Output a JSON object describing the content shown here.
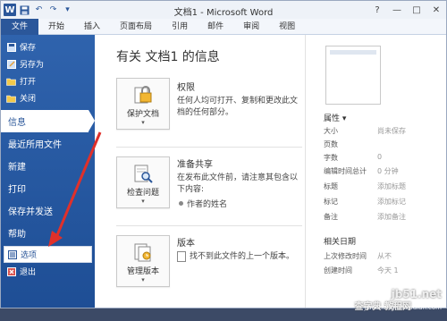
{
  "titlebar": {
    "title": "文档1 - Microsoft Word",
    "logo_letter": "W",
    "qat": [
      "save-icon",
      "undo-icon",
      "redo-icon",
      "customize-icon"
    ],
    "controls": {
      "help": "?",
      "minimize": "—",
      "restore": "□",
      "close": "✕"
    }
  },
  "tabs": [
    "文件",
    "开始",
    "插入",
    "页面布局",
    "引用",
    "邮件",
    "审阅",
    "视图"
  ],
  "sidebar": {
    "commands_top": [
      {
        "label": "保存",
        "icon": "save-icon"
      },
      {
        "label": "另存为",
        "icon": "save-as-icon"
      },
      {
        "label": "打开",
        "icon": "open-folder-icon"
      },
      {
        "label": "关闭",
        "icon": "close-folder-icon"
      }
    ],
    "tabs": [
      "信息",
      "最近所用文件",
      "新建",
      "打印",
      "保存并发送",
      "帮助"
    ],
    "active_tab": "信息",
    "commands_bottom": [
      {
        "label": "选项",
        "icon": "options-icon"
      },
      {
        "label": "退出",
        "icon": "exit-icon"
      }
    ]
  },
  "main": {
    "title": "有关 文档1 的信息",
    "permissions": {
      "button_label": "保护文档",
      "title": "权限",
      "desc": "任何人均可打开、复制和更改此文档的任何部分。"
    },
    "sharing": {
      "button_label": "检查问题",
      "title": "准备共享",
      "desc": "在发布此文件前，请注意其包含以下内容:",
      "bullet": "作者的姓名"
    },
    "versions": {
      "button_label": "管理版本",
      "title": "版本",
      "desc": "找不到此文件的上一个版本。"
    }
  },
  "properties": {
    "header": "属性 ▾",
    "rows": [
      {
        "k": "大小",
        "v": "尚未保存"
      },
      {
        "k": "页数",
        "v": ""
      },
      {
        "k": "字数",
        "v": "0"
      },
      {
        "k": "编辑时间总计",
        "v": "0 分钟"
      },
      {
        "k": "标题",
        "v": "添加标题"
      },
      {
        "k": "标记",
        "v": "添加标记"
      },
      {
        "k": "备注",
        "v": "添加备注"
      }
    ],
    "dates_header": "相关日期",
    "date_rows": [
      {
        "k": "上次修改时间",
        "v": "从不"
      },
      {
        "k": "创建时间",
        "v": "今天 1"
      }
    ]
  },
  "watermark": {
    "site": "jb51.net",
    "cn": "查字典 教程网",
    "url": "jiaocheng.chazidian.com"
  },
  "colors": {
    "accent": "#2b579a",
    "arrow": "#e0302a"
  }
}
